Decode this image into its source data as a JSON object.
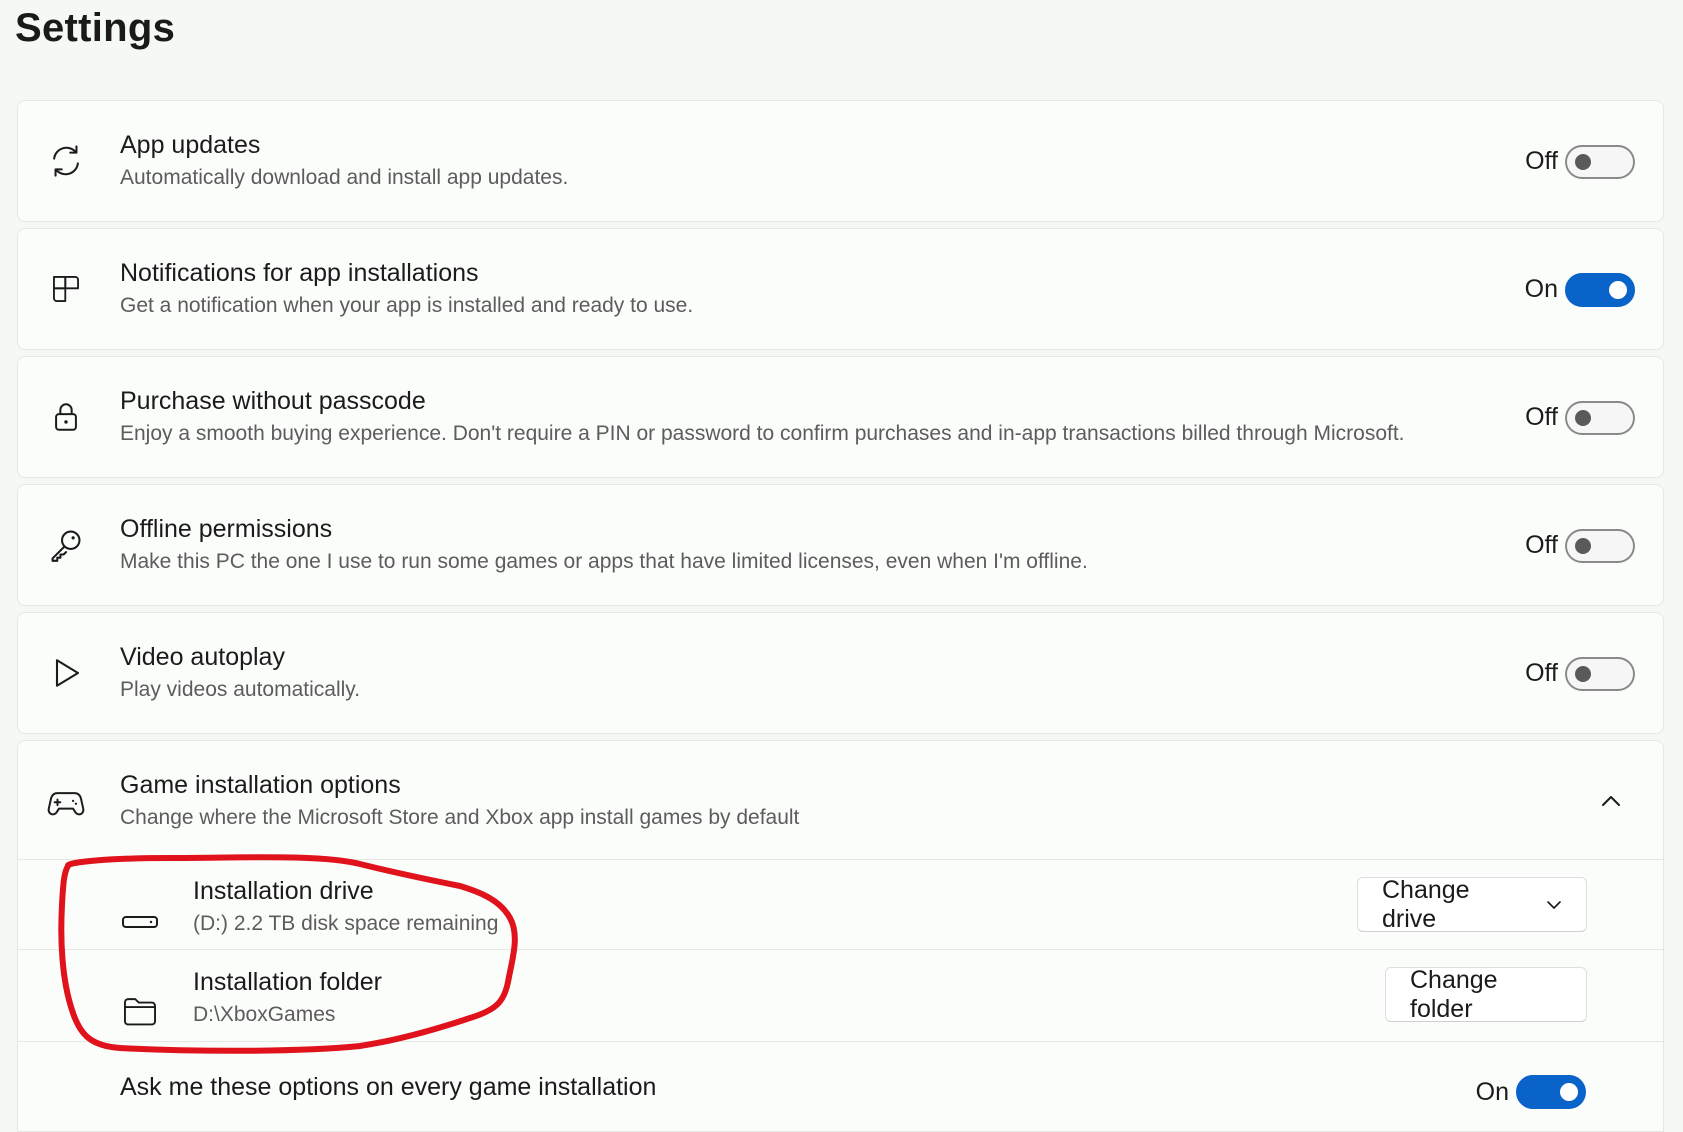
{
  "page": {
    "title": "Settings"
  },
  "settings": [
    {
      "icon": "refresh-icon",
      "title": "App updates",
      "description": "Automatically download and install app updates.",
      "state_label": "Off",
      "on": false
    },
    {
      "icon": "notification-grid-icon",
      "title": "Notifications for app installations",
      "description": "Get a notification when your app is installed and ready to use.",
      "state_label": "On",
      "on": true
    },
    {
      "icon": "lock-icon",
      "title": "Purchase without passcode",
      "description": "Enjoy a smooth buying experience. Don't require a PIN or password to confirm purchases and in-app transactions billed through Microsoft.",
      "state_label": "Off",
      "on": false
    },
    {
      "icon": "key-icon",
      "title": "Offline permissions",
      "description": "Make this PC the one I use to run some games or apps that have limited licenses, even when I'm offline.",
      "state_label": "Off",
      "on": false
    },
    {
      "icon": "play-icon",
      "title": "Video autoplay",
      "description": "Play videos automatically.",
      "state_label": "Off",
      "on": false
    }
  ],
  "game_install": {
    "icon": "game-controller-icon",
    "title": "Game installation options",
    "description": "Change where the Microsoft Store and Xbox app install games by default",
    "expanded": true,
    "drive": {
      "icon": "drive-icon",
      "title": "Installation drive",
      "description": "(D:) 2.2 TB disk space remaining",
      "button_label": "Change drive"
    },
    "folder": {
      "icon": "folder-icon",
      "title": "Installation folder",
      "description": "D:\\XboxGames",
      "button_label": "Change folder"
    },
    "ask": {
      "title": "Ask me these options on every game installation",
      "state_label": "On",
      "on": true
    }
  },
  "colors": {
    "accent": "#0a63c9",
    "annotation": "#e0121b",
    "background": "#f4f9f4"
  }
}
